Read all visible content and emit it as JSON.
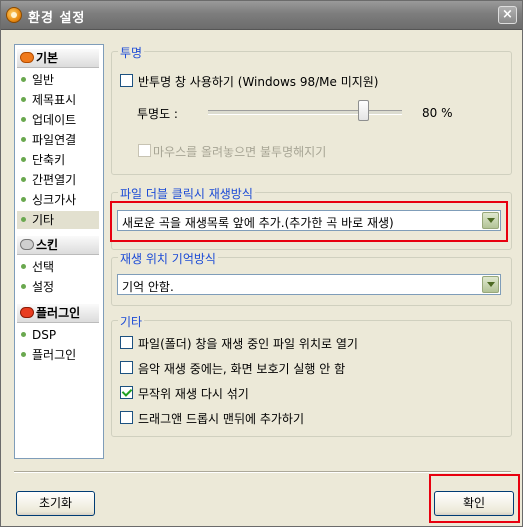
{
  "window": {
    "title": "환경 설정",
    "close_glyph": "×",
    "app_icon": "app-icon"
  },
  "sidebar": {
    "categories": [
      {
        "label": "기본",
        "icon": "basic-category-icon"
      },
      {
        "label": "스킨",
        "icon": "skin-category-icon"
      },
      {
        "label": "플러그인",
        "icon": "plugin-category-icon"
      }
    ],
    "items": [
      {
        "label": "일반"
      },
      {
        "label": "제목표시"
      },
      {
        "label": "업데이트"
      },
      {
        "label": "파일연결"
      },
      {
        "label": "단축키"
      },
      {
        "label": "간편열기"
      },
      {
        "label": "싱크가사"
      },
      {
        "label": "기타"
      },
      {
        "label": "선택"
      },
      {
        "label": "설정"
      },
      {
        "label": "DSP"
      },
      {
        "label": "플러그인"
      }
    ],
    "selected_item": "기타"
  },
  "transparency": {
    "title": "투명",
    "enable_label": "반투명 창 사용하기 (Windows 98/Me 미지원)",
    "enable_checked": false,
    "level_label": "투명도 :",
    "level_value": "80 %",
    "level_fraction": 0.8,
    "mouseover_label": "마우스를 올려놓으면 불투명해지기",
    "mouseover_checked": false,
    "mouseover_disabled": true
  },
  "doubleclick": {
    "title": "파일 더블 클릭시 재생방식",
    "selected": "새로운 곡을 재생목록 앞에 추가.(추가한 곡 바로 재생)"
  },
  "position_memory": {
    "title": "재생 위치 기억방식",
    "selected": "기억 안함."
  },
  "misc": {
    "title": "기타",
    "options": [
      {
        "label": "파일(폴더) 창을 재생 중인 파일 위치로 열기",
        "checked": false
      },
      {
        "label": "음악 재생 중에는, 화면 보호기 실행 안 함",
        "checked": false
      },
      {
        "label": "무작위 재생 다시 섞기",
        "checked": true
      },
      {
        "label": "드래그앤 드롭시 맨뒤에 추가하기",
        "checked": false
      }
    ]
  },
  "buttons": {
    "reset": "초기화",
    "ok": "확인"
  },
  "colors": {
    "highlight": "#e8000f",
    "group_title": "#1c4bd6",
    "dialog_bg": "#ece9d8"
  }
}
